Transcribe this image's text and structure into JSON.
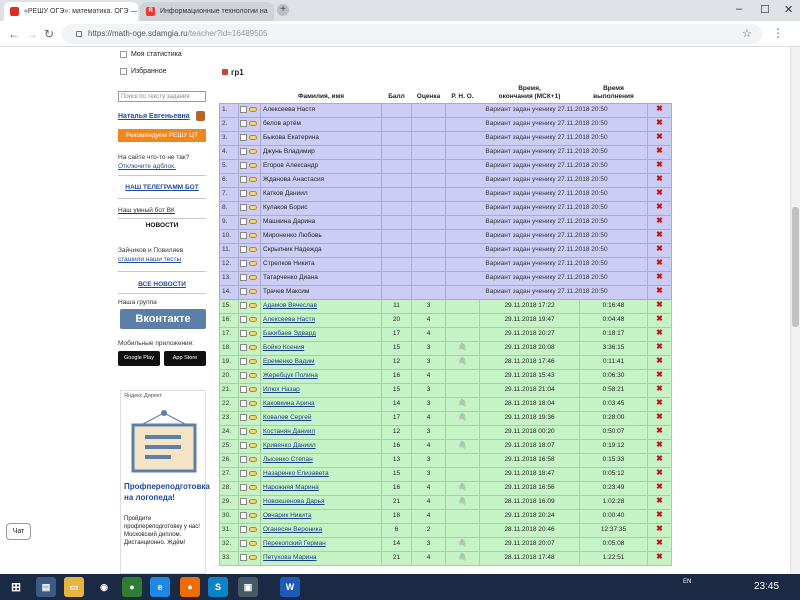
{
  "browser": {
    "tabs": [
      {
        "title": "«РЕШУ ОГЭ»: математика. ОГЭ —",
        "favicon_color": "#d93025",
        "active": true
      },
      {
        "title": "Информационные технологии на",
        "favicon_color": "#e53935",
        "active": false
      }
    ],
    "favicon_glyph": "Я",
    "url_host": "https://math-oge.sdamgia.ru",
    "url_path": "/teacher?id=16489505"
  },
  "sidebar": {
    "stats_label": "Моя статистика",
    "favorites_label": "Избранное",
    "search_placeholder": "Поиск по тексту задания",
    "user_name": "Наталья Евгеньевна",
    "recommend_btn": "Рекомендуем РЕШУ ЦТ",
    "adblock_line1": "На сайте что-то не так?",
    "adblock_line2": "Отключите адблок.",
    "telegram_channel": "НАШ ТЕЛЕГРАММ БОТ",
    "vk_bot": "Наш умный бот ВК",
    "news_heading": "НОВОСТИ",
    "news_line1": "Зайчиков и Повиляев",
    "news_line2": "сташили наши тесты",
    "all_news": "ВСЕ НОВОСТИ",
    "our_group": "Наша группа",
    "vk_button": "Вконтакте",
    "mobile_apps": "Мобильные приложения:",
    "google_play": "Google Play",
    "app_store": "App Store",
    "ad_label": "Яндекс.Директ",
    "ad_title": "Профпереподготовка на логопеда!",
    "ad_desc": "Пройдите профпереподготовку у нас! Московский диплом. Дистанционно. Ждём!"
  },
  "chat_label": "Чат",
  "group": {
    "name": "гр1"
  },
  "table": {
    "headers": {
      "name": "Фамилия, имя",
      "score": "Балл",
      "grade": "Оценка",
      "rno": "Р. Н. О.",
      "end_time_l1": "Время,",
      "end_time_l2": "окончания (МСК+1)",
      "exec_l1": "Время",
      "exec_l2": "выполнения"
    },
    "assigned_text": "Вариант задан ученику 27.11.2018 20:50",
    "rows": [
      {
        "n": "1.",
        "name": "Алексеева Настя",
        "status": "assigned"
      },
      {
        "n": "2.",
        "name": "белов артём",
        "status": "assigned"
      },
      {
        "n": "3.",
        "name": "Быкова Екатерина",
        "status": "assigned"
      },
      {
        "n": "4.",
        "name": "Джунь Владимир",
        "status": "assigned"
      },
      {
        "n": "5.",
        "name": "Егоров Александр",
        "status": "assigned"
      },
      {
        "n": "6.",
        "name": "Жданова Анастасия",
        "status": "assigned"
      },
      {
        "n": "7.",
        "name": "Катков Даниил",
        "status": "assigned"
      },
      {
        "n": "8.",
        "name": "Кулаков Борис",
        "status": "assigned"
      },
      {
        "n": "9.",
        "name": "Машкина Дарина",
        "status": "assigned"
      },
      {
        "n": "10.",
        "name": "Мироненко Любовь",
        "status": "assigned"
      },
      {
        "n": "11.",
        "name": "Скрыпник Надежда",
        "status": "assigned"
      },
      {
        "n": "12.",
        "name": "Стрелков Никита",
        "status": "assigned"
      },
      {
        "n": "13.",
        "name": "Татарченко Диана",
        "status": "assigned"
      },
      {
        "n": "14.",
        "name": "Трачев Максим",
        "status": "assigned"
      },
      {
        "n": "15.",
        "name": "Адамов Вячеслав",
        "score": "11",
        "grade": "3",
        "clip": false,
        "end": "29.11.2018 17:22",
        "dur": "0:16:48",
        "status": "done"
      },
      {
        "n": "16.",
        "name": "Алексеева Настя",
        "score": "20",
        "grade": "4",
        "clip": false,
        "end": "29.11.2018 19:47",
        "dur": "0:04:48",
        "status": "done"
      },
      {
        "n": "17.",
        "name": "Бакибаев Эдвард",
        "score": "17",
        "grade": "4",
        "clip": false,
        "end": "29.11.2018 20:27",
        "dur": "0:18:17",
        "status": "done"
      },
      {
        "n": "18.",
        "name": "Бойко Ксения",
        "score": "15",
        "grade": "3",
        "clip": true,
        "end": "29.11.2018 20:08",
        "dur": "3:36:15",
        "status": "done"
      },
      {
        "n": "19.",
        "name": "Еременко Вадим",
        "score": "12",
        "grade": "3",
        "clip": true,
        "end": "28.11.2018 17:46",
        "dur": "0:11:41",
        "status": "done"
      },
      {
        "n": "20.",
        "name": "Жеребцук Полина",
        "score": "16",
        "grade": "4",
        "clip": false,
        "end": "29.11.2018 15:43",
        "dur": "0:06:30",
        "status": "done"
      },
      {
        "n": "21.",
        "name": "Илюх Назар",
        "score": "15",
        "grade": "3",
        "clip": false,
        "end": "29.11.2018 21:04",
        "dur": "0:58:21",
        "status": "done"
      },
      {
        "n": "22.",
        "name": "Каковкина Арина",
        "score": "14",
        "grade": "3",
        "clip": true,
        "end": "28.11.2018 18:04",
        "dur": "0:03:45",
        "status": "done"
      },
      {
        "n": "23.",
        "name": "Ковалев Сергей",
        "score": "17",
        "grade": "4",
        "clip": true,
        "end": "29.11.2018 19:36",
        "dur": "0:28:00",
        "status": "done"
      },
      {
        "n": "24.",
        "name": "Костанян Даниил",
        "score": "12",
        "grade": "3",
        "clip": false,
        "end": "29.11.2018 00:20",
        "dur": "0:50:07",
        "status": "done"
      },
      {
        "n": "25.",
        "name": "Кривенко Даниил",
        "score": "16",
        "grade": "4",
        "clip": true,
        "end": "29.11.2018 18:07",
        "dur": "0:19:12",
        "status": "done"
      },
      {
        "n": "26.",
        "name": "Лысенко Степан",
        "score": "13",
        "grade": "3",
        "clip": false,
        "end": "29.11.2018 16:58",
        "dur": "0:15:33",
        "status": "done"
      },
      {
        "n": "27.",
        "name": "Назаренко Елизавета",
        "score": "15",
        "grade": "3",
        "clip": false,
        "end": "29.11.2018 18:47",
        "dur": "0:05:12",
        "status": "done"
      },
      {
        "n": "28.",
        "name": "Нарожняя Марина",
        "score": "16",
        "grade": "4",
        "clip": true,
        "end": "29.11.2018 16:56",
        "dur": "0:23:49",
        "status": "done"
      },
      {
        "n": "29.",
        "name": "Новокшенова Дарья",
        "score": "21",
        "grade": "4",
        "clip": true,
        "end": "28.11.2018 16:09",
        "dur": "1:02:28",
        "status": "done"
      },
      {
        "n": "30.",
        "name": "Овчарик Никита",
        "score": "18",
        "grade": "4",
        "clip": false,
        "end": "29.11.2018 20:24",
        "dur": "0:00:40",
        "status": "done"
      },
      {
        "n": "31.",
        "name": "Оганесян Вероника",
        "score": "6",
        "grade": "2",
        "clip": false,
        "end": "28.11.2018 20:46",
        "dur": "12:37:35",
        "status": "done"
      },
      {
        "n": "32.",
        "name": "Перекопский Герман",
        "score": "14",
        "grade": "3",
        "clip": true,
        "end": "29.11.2018 20:07",
        "dur": "0:05:08",
        "status": "done"
      },
      {
        "n": "33.",
        "name": "Петухова Марина",
        "score": "21",
        "grade": "4",
        "clip": true,
        "end": "28.11.2018 17:48",
        "dur": "1:22:51",
        "status": "done"
      }
    ]
  },
  "taskbar": {
    "lang": "EN",
    "time": "23:45",
    "word_letter": "W"
  }
}
